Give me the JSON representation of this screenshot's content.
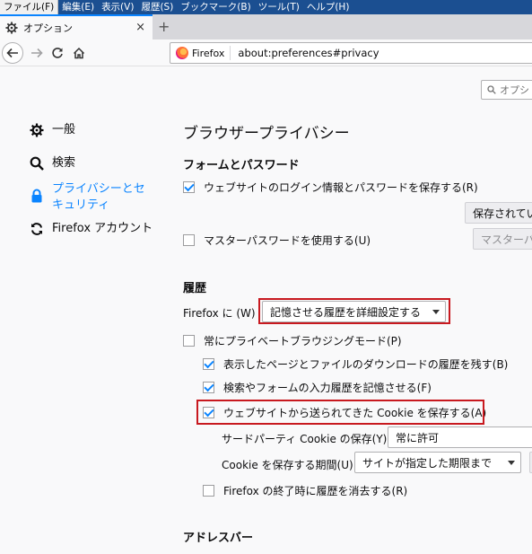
{
  "menubar": [
    "ファイル(F)",
    "編集(E)",
    "表示(V)",
    "履歴(S)",
    "ブックマーク(B)",
    "ツール(T)",
    "ヘルプ(H)"
  ],
  "tab": {
    "title": "オプション",
    "close": "×",
    "new_tab": "+"
  },
  "urlbar": {
    "identity": "Firefox",
    "url": "about:preferences#privacy"
  },
  "search": {
    "placeholder": "オプシ"
  },
  "sidebar": {
    "items": [
      {
        "label": "一般",
        "icon": "gear-icon"
      },
      {
        "label": "検索",
        "icon": "search-icon"
      },
      {
        "label_line1": "プライバシーとセ",
        "label_line2": "キュリティ",
        "icon": "lock-icon",
        "selected": true
      },
      {
        "label": "Firefox アカウント",
        "icon": "sync-icon"
      }
    ]
  },
  "main": {
    "title": "ブラウザープライバシー",
    "forms": {
      "heading": "フォームとパスワード",
      "save_logins": {
        "label": "ウェブサイトのログイン情報とパスワードを保存する(R)",
        "checked": true
      },
      "saved_button": "保存されてい",
      "master_password": {
        "label": "マスターパスワードを使用する(U)",
        "checked": false
      },
      "master_button": "マスターパ"
    },
    "history": {
      "heading": "履歴",
      "firefox_label": "Firefox に (W)",
      "mode_select": "記憶させる履歴を詳細設定する",
      "always_private": {
        "label": "常にプライベートブラウジングモード(P)",
        "checked": false
      },
      "remember_browsing": {
        "label": "表示したページとファイルのダウンロードの履歴を残す(B)",
        "checked": true
      },
      "remember_search": {
        "label": "検索やフォームの入力履歴を記憶させる(F)",
        "checked": true
      },
      "accept_cookies": {
        "label": "ウェブサイトから送られてきた Cookie を保存する(A)",
        "checked": true
      },
      "third_party_label": "サードパーティ Cookie の保存(Y)",
      "third_party_select": "常に許可",
      "keep_until_label": "Cookie を保存する期間(U)",
      "keep_until_select": "サイトが指定した期限まで",
      "clear_on_close": {
        "label": "Firefox の終了時に履歴を消去する(R)",
        "checked": false
      }
    },
    "addressbar": {
      "heading": "アドレスバー"
    }
  },
  "colors": {
    "accent": "#0a84ff",
    "highlight": "#c8191f",
    "menubar": "#1b4f91"
  }
}
